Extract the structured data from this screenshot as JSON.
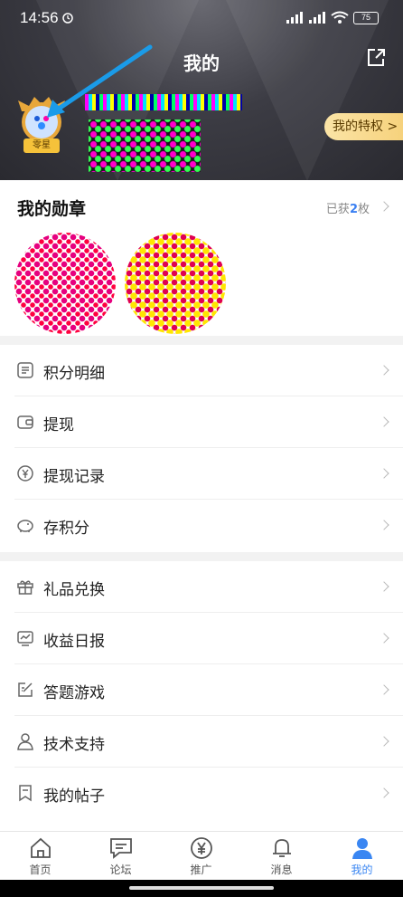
{
  "status_bar": {
    "time": "14:56",
    "battery": "75"
  },
  "header": {
    "title": "我的",
    "level_badge": "零星",
    "privilege_button": "我的特权 >"
  },
  "medals": {
    "title": "我的勋章",
    "count_prefix": "已获",
    "count_value": "2",
    "count_suffix": "枚"
  },
  "menu_group_1": [
    {
      "label": "积分明细",
      "icon": "list-icon"
    },
    {
      "label": "提现",
      "icon": "wallet-icon"
    },
    {
      "label": "提现记录",
      "icon": "yuan-circle-icon"
    },
    {
      "label": "存积分",
      "icon": "piggy-bank-icon"
    }
  ],
  "menu_group_2": [
    {
      "label": "礼品兑换",
      "icon": "gift-icon"
    },
    {
      "label": "收益日报",
      "icon": "chart-icon"
    },
    {
      "label": "答题游戏",
      "icon": "edit-icon"
    },
    {
      "label": "技术支持",
      "icon": "person-icon"
    },
    {
      "label": "我的帖子",
      "icon": "bookmark-icon"
    }
  ],
  "tabbar": [
    {
      "label": "首页",
      "icon": "home-icon"
    },
    {
      "label": "论坛",
      "icon": "chat-icon"
    },
    {
      "label": "推广",
      "icon": "yuan-icon"
    },
    {
      "label": "消息",
      "icon": "bell-icon"
    },
    {
      "label": "我的",
      "icon": "user-icon",
      "active": true
    }
  ],
  "colors": {
    "accent": "#3a86f2",
    "header_bg": "#3c3c44",
    "privilege_bg": "#f6d17a"
  }
}
